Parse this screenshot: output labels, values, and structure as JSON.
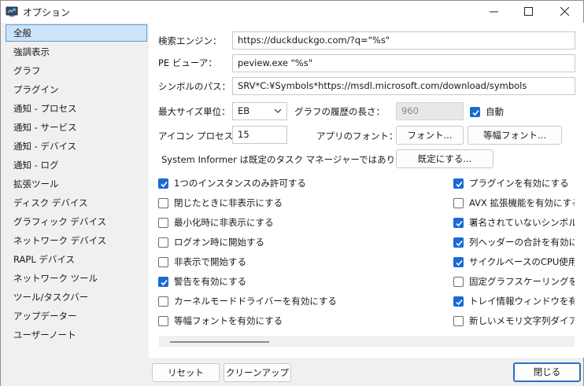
{
  "window": {
    "title": "オプション",
    "icon": "system-informer-app-icon",
    "controls": [
      "minimize-icon",
      "maximize-icon",
      "close-icon"
    ]
  },
  "sidebar": {
    "items": [
      {
        "label": "全般",
        "selected": true
      },
      {
        "label": "強調表示"
      },
      {
        "label": "グラフ"
      },
      {
        "label": "プラグイン"
      },
      {
        "label": "通知 - プロセス"
      },
      {
        "label": "通知 - サービス"
      },
      {
        "label": "通知 - デバイス"
      },
      {
        "label": "通知 - ログ"
      },
      {
        "label": "拡張ツール"
      },
      {
        "label": "ディスク デバイス"
      },
      {
        "label": "グラフィック デバイス"
      },
      {
        "label": "ネットワーク デバイス"
      },
      {
        "label": "RAPL デバイス"
      },
      {
        "label": "ネットワーク ツール"
      },
      {
        "label": "ツール/タスクバー"
      },
      {
        "label": "アップデーター"
      },
      {
        "label": "ユーザーノート"
      }
    ]
  },
  "general": {
    "search_engine_label": "検索エンジン：",
    "search_engine_value": "https://duckduckgo.com/?q=\"%s\"",
    "pe_viewer_label": "PE ビューア：",
    "pe_viewer_value": "peview.exe \"%s\"",
    "symbol_path_label": "シンボルのパス：",
    "symbol_path_value": "SRV*C:¥Symbols*https://msdl.microsoft.com/download/symbols",
    "max_size_unit_label": "最大サイズ単位：",
    "max_size_unit_value": "EB",
    "graph_history_label": "グラフの履歴の長さ：",
    "graph_history_value": "960",
    "auto_label": "自動",
    "auto_checked": true,
    "icon_process_label": "アイコン プロセス：",
    "icon_process_value": "15",
    "app_font_label": "アプリのフォント：",
    "font_button": "フォント...",
    "mono_font_button": "等幅フォント...",
    "default_taskmgr_text": "System Informer は既定のタスク マネージャーではありません：",
    "make_default_button": "既定にする..."
  },
  "options_left": [
    {
      "label": "1つのインスタンスのみ許可する",
      "checked": true
    },
    {
      "label": "閉じたときに非表示にする",
      "checked": false
    },
    {
      "label": "最小化時に非表示にする",
      "checked": false
    },
    {
      "label": "ログオン時に開始する",
      "checked": false
    },
    {
      "label": "非表示で開始する",
      "checked": false
    },
    {
      "label": "警告を有効にする",
      "checked": true
    },
    {
      "label": "カーネルモードドライバーを有効にする",
      "checked": false
    },
    {
      "label": "等幅フォントを有効にする",
      "checked": false
    }
  ],
  "options_right": [
    {
      "label": "プラグインを有効にする",
      "checked": true
    },
    {
      "label": "AVX 拡張機能を有効にする",
      "checked": false
    },
    {
      "label": "署名されていないシンボルを有",
      "checked": true
    },
    {
      "label": "列ヘッダーの合計を有効にす",
      "checked": true
    },
    {
      "label": "サイクルベースのCPU使用率",
      "checked": true
    },
    {
      "label": "固定グラフスケーリングを有効",
      "checked": false
    },
    {
      "label": "トレイ情報ウィンドウを有効に",
      "checked": true
    },
    {
      "label": "新しいメモリ文字列ダイアログ",
      "checked": false
    }
  ],
  "footer": {
    "reset_button": "リセット",
    "cleanup_button": "クリーンアップ",
    "close_button": "閉じる"
  },
  "colors": {
    "accent": "#1a6bd1",
    "selection": "#cce4f7",
    "selection_border": "#5b9bd5"
  }
}
